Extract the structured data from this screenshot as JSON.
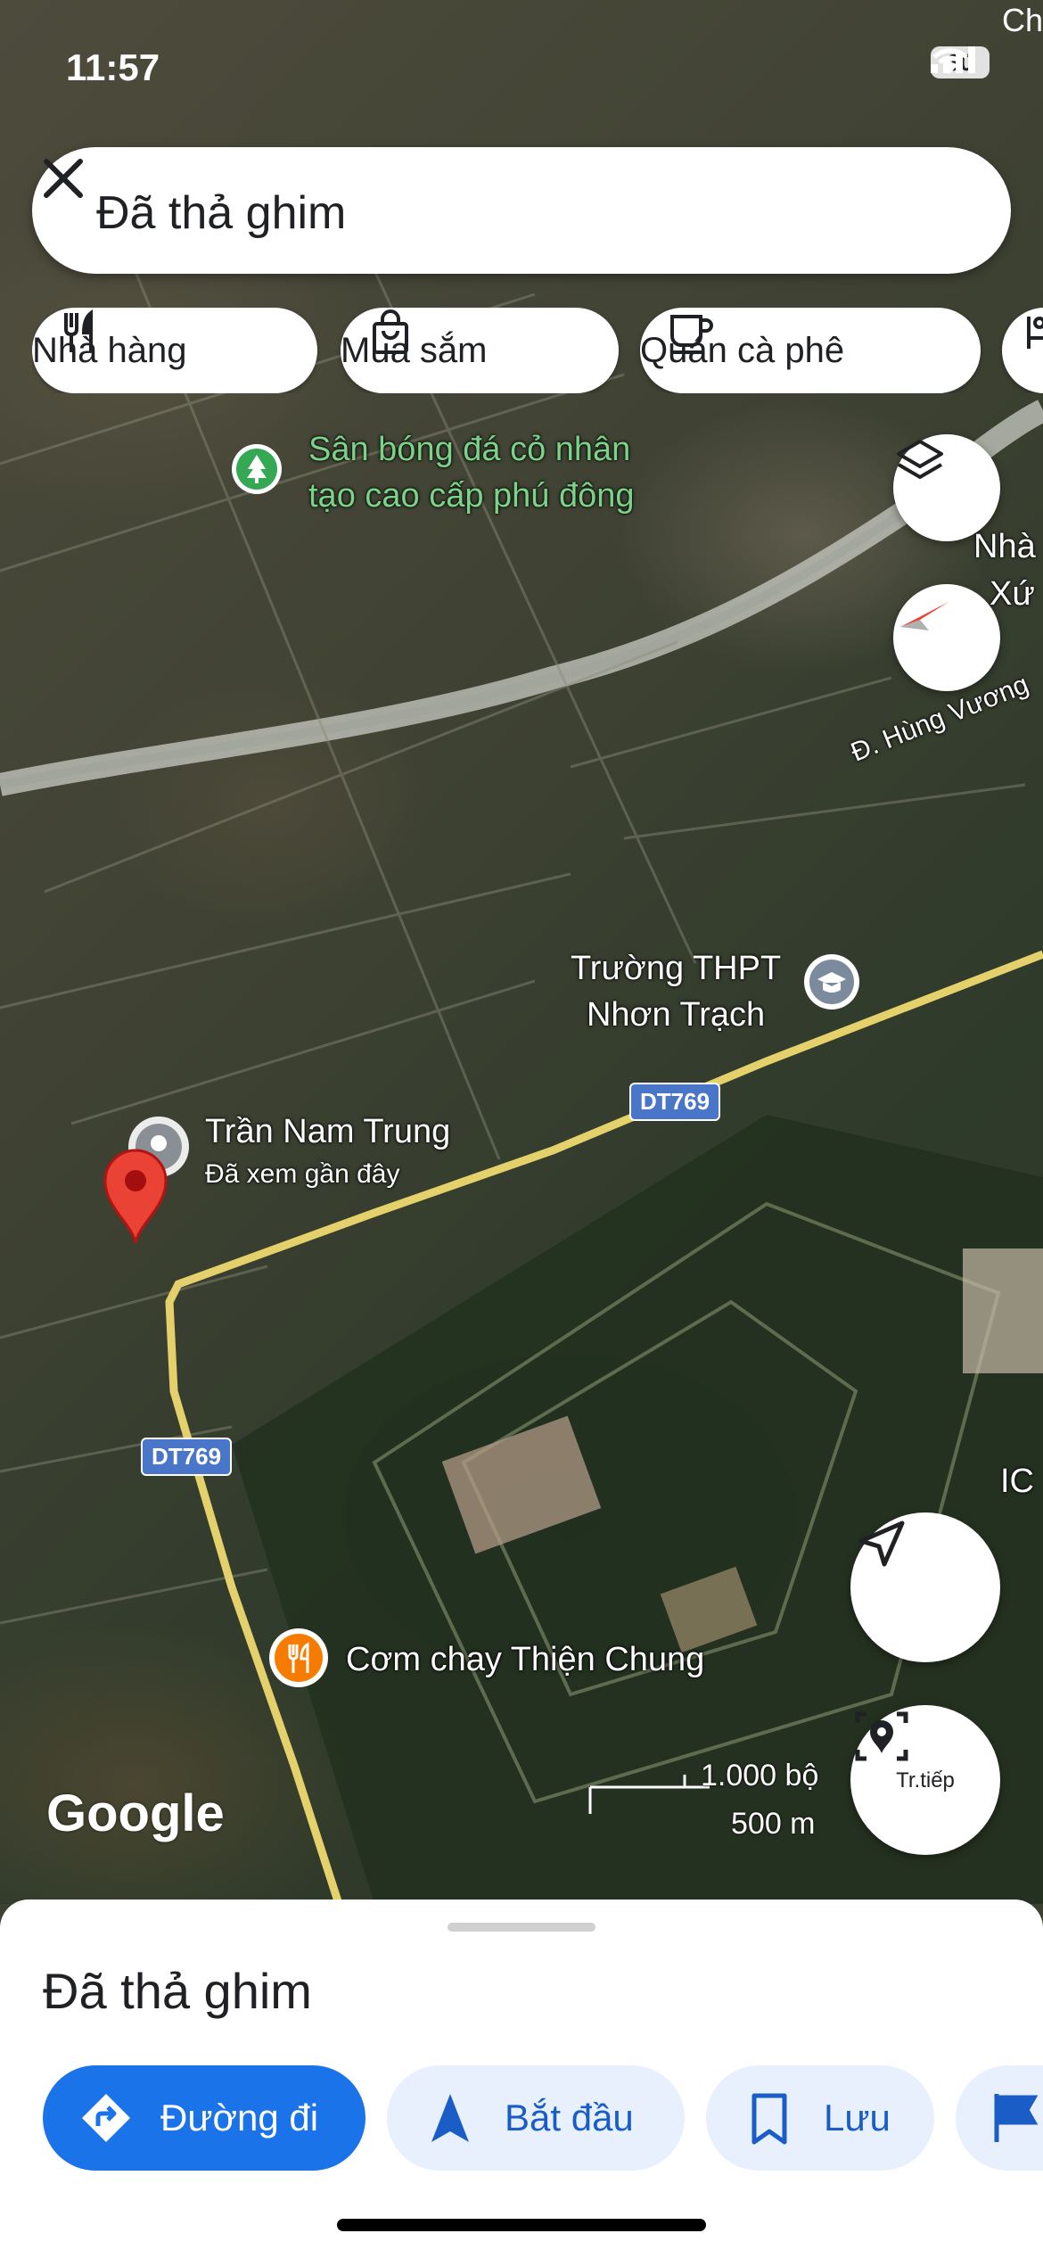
{
  "status_bar": {
    "time": "11:57",
    "battery": "30",
    "corner_text": "Ch"
  },
  "search": {
    "title": "Đã thả ghim"
  },
  "chips": [
    {
      "label": "Nhà hàng",
      "icon": "fork-knife-icon"
    },
    {
      "label": "Mua sắm",
      "icon": "shopping-bag-icon"
    },
    {
      "label": "Quán cà phê",
      "icon": "coffee-cup-icon"
    }
  ],
  "map": {
    "places": {
      "stadium_line1": "Sân bóng đá cỏ nhân",
      "stadium_line2": "tạo cao cấp phú đông",
      "school_line1": "Trường THPT",
      "school_line2": "Nhơn Trạch",
      "pin_name": "Trần Nam Trung",
      "pin_sub": "Đã xem gần đây",
      "restaurant": "Cơm chay Thiện Chung",
      "edge_nha": "Nhà",
      "edge_xu": "Xứ",
      "edge_ic": "IC",
      "road_hung_vuong": "Đ. Hùng Vương"
    },
    "road_badge_1": "DT769",
    "road_badge_2": "DT769",
    "scale_feet": "1.000 bộ",
    "scale_meters": "500 m",
    "google_logo": "Google",
    "live_view_label": "Tr.tiếp"
  },
  "sheet": {
    "title": "Đã thả ghim",
    "actions": [
      {
        "label": "Đường đi",
        "icon": "directions-icon"
      },
      {
        "label": "Bắt đầu",
        "icon": "navigation-arrow-icon"
      },
      {
        "label": "Lưu",
        "icon": "bookmark-icon"
      }
    ]
  },
  "colors": {
    "accent_blue": "#1a73e8",
    "light_blue_chip": "#e8f0fe",
    "pin_red": "#ea4335",
    "restaurant_orange": "#f57c00",
    "park_green": "#34a853"
  }
}
